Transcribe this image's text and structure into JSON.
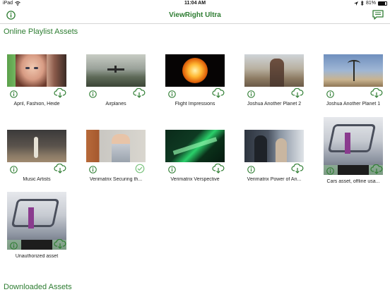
{
  "status": {
    "device": "iPad",
    "time": "11:04 AM",
    "battery": "81%",
    "battery_level": 0.81
  },
  "nav": {
    "title": "ViewRight Ultra",
    "left_icon": "info-icon",
    "right_icon": "chat-icon"
  },
  "sections": {
    "online_title": "Online Playlist Assets",
    "downloaded_title": "Downloaded Assets"
  },
  "assets": [
    {
      "title": "April, Fashion, Heide",
      "action": "download"
    },
    {
      "title": "Airplanes",
      "action": "download"
    },
    {
      "title": "Flight Impressions",
      "action": "download"
    },
    {
      "title": "Joshua Another Planet 2",
      "action": "download"
    },
    {
      "title": "Joshua Another Planet 1",
      "action": "download"
    },
    {
      "title": "Music Artists",
      "action": "download"
    },
    {
      "title": "Verimatrix Securing th...",
      "action": "downloaded"
    },
    {
      "title": "Verimatrix Verspective",
      "action": "download"
    },
    {
      "title": "Verimatrix Power of An...",
      "action": "download"
    },
    {
      "title": "Cars asset, offline usa...",
      "action": "download"
    },
    {
      "title": "Unauthorized asset",
      "action": "download"
    }
  ],
  "colors": {
    "accent": "#2e7d32",
    "downloaded_check": "#7cc47f"
  }
}
